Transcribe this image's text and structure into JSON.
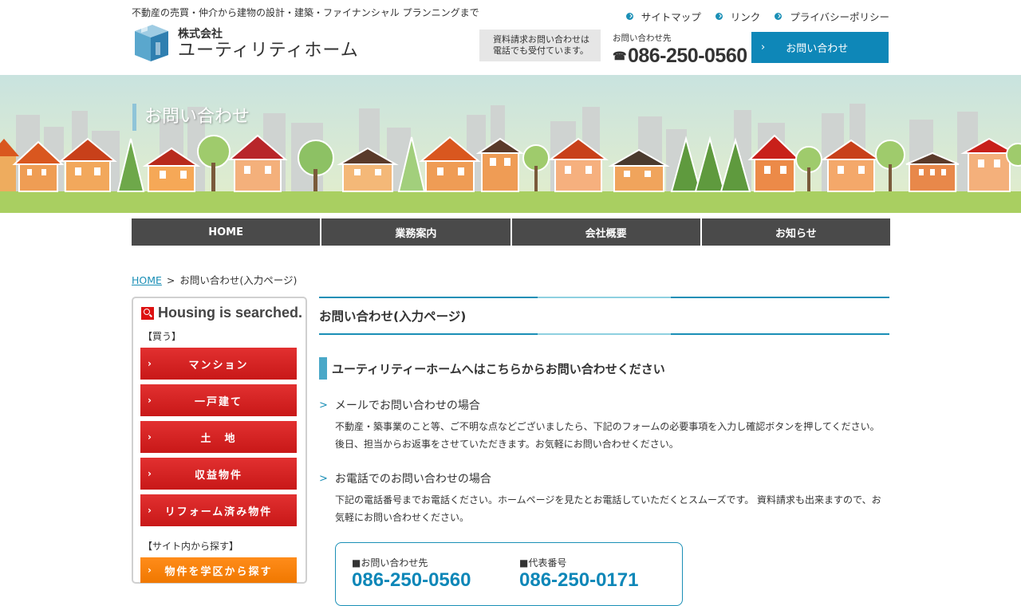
{
  "header": {
    "tagline": "不動産の売買・仲介から建物の設計・建築・ファイナンシャル プランニングまで",
    "logo_small": "株式会社",
    "logo_big": "ユーティリティホーム",
    "toplinks": [
      "サイトマップ",
      "リンク",
      "プライバシーポリシー"
    ],
    "note_line1": "資料請求お問い合わせは",
    "note_line2": "電話でも受付ています。",
    "phone_label": "お問い合わせ先",
    "phone_number": "086-250-0560",
    "contact_button": "お問い合わせ",
    "accent_color": "#0e87b8"
  },
  "hero": {
    "title": "お問い合わせ"
  },
  "nav": [
    "HOME",
    "業務案内",
    "会社概要",
    "お知らせ"
  ],
  "breadcrumb": {
    "home": "HOME",
    "separator": ">",
    "current": "お問い合わせ(入力ページ)"
  },
  "sidebar": {
    "heading": "Housing is searched.",
    "category_buy": "【買う】",
    "buttons": [
      "マンション",
      "一戸建て",
      "土　地",
      "収益物件",
      "リフォーム済み物件"
    ],
    "category_search": "【サイト内から探す】",
    "search_button": "物件を学区から探す"
  },
  "main": {
    "page_heading": "お問い合わせ(入力ページ)",
    "sub_heading": "ユーティリティーホームへはこちらからお問い合わせください",
    "sections": [
      {
        "title": "メールでお問い合わせの場合",
        "line1": "不動産・築事業のこと等、ご不明な点などございましたら、下記のフォームの必要事項を入力し確認ボタンを押してください。",
        "line2": "後日、担当からお返事をさせていただきます。お気軽にお問い合わせください。"
      },
      {
        "title": "お電話でのお問い合わせの場合",
        "line1": "下記の電話番号までお電話ください。ホームページを見たとお電話していただくとスムーズです。 資料請求も出来ますので、お",
        "line2": "気軽にお問い合わせください。"
      }
    ],
    "phone_card": {
      "label1": "■お問い合わせ先",
      "number1": "086-250-0560",
      "label2": "■代表番号",
      "number2": "086-250-0171"
    }
  }
}
